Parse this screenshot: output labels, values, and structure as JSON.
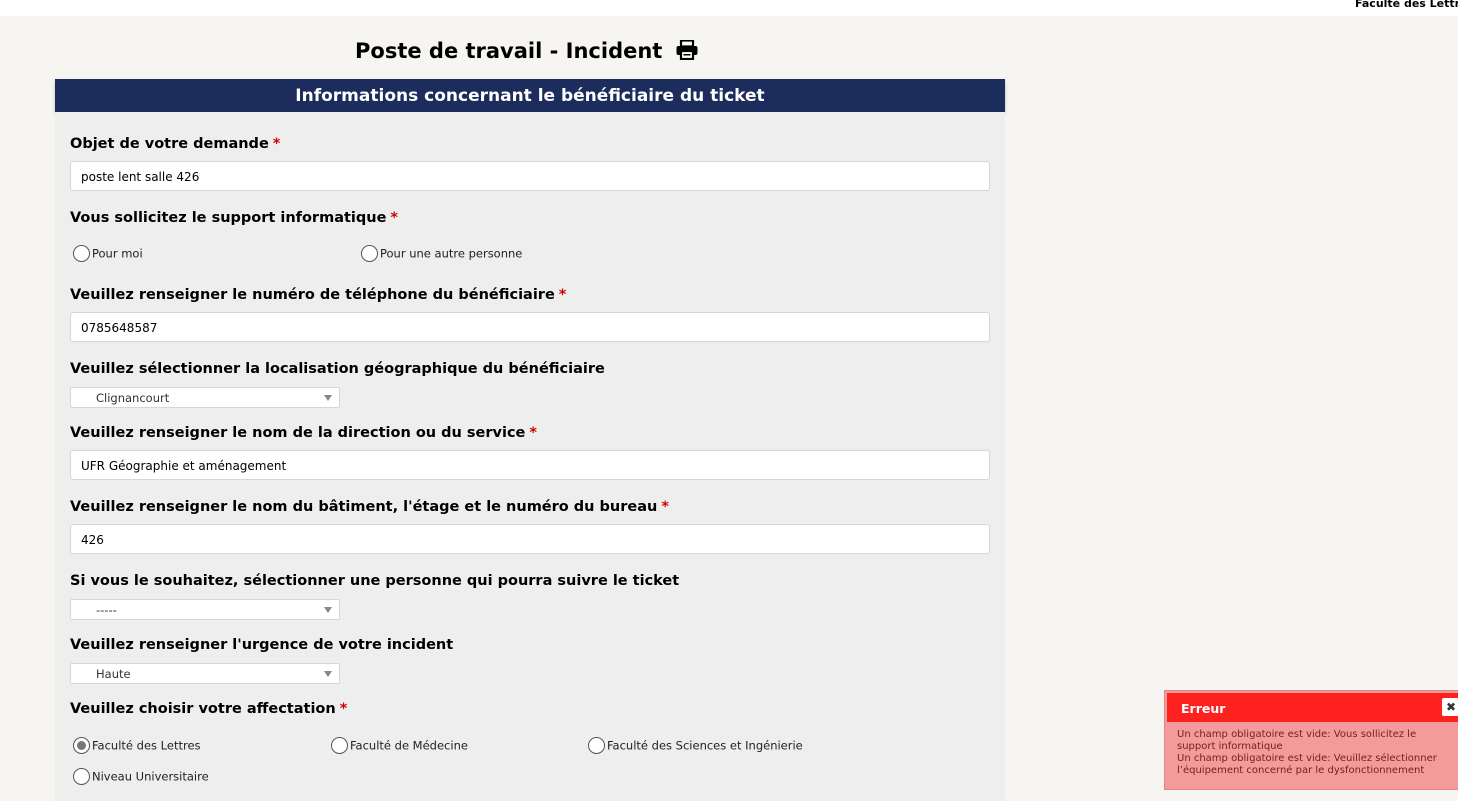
{
  "topbar": {
    "right_text": "Faculté des Lettres"
  },
  "page": {
    "title": "Poste de travail - Incident"
  },
  "section": {
    "header": "Informations concernant le bénéficiaire du ticket"
  },
  "form": {
    "objet": {
      "label": "Objet de votre demande",
      "value": "poste lent salle 426"
    },
    "support": {
      "label": "Vous sollicitez le support informatique",
      "options": [
        "Pour moi",
        "Pour une autre personne"
      ],
      "selected": null
    },
    "telephone": {
      "label": "Veuillez renseigner le numéro de téléphone du bénéficiaire",
      "value": "0785648587"
    },
    "localisation": {
      "label": "Veuillez sélectionner la localisation géographique du bénéficiaire",
      "value": "Clignancourt"
    },
    "direction": {
      "label": "Veuillez renseigner le nom de la direction ou du service",
      "value": "UFR Géographie et aménagement"
    },
    "batiment": {
      "label": "Veuillez renseigner le nom du bâtiment, l'étage et le numéro du bureau",
      "value": "426"
    },
    "suivi": {
      "label": "Si vous le souhaitez, sélectionner une personne qui pourra suivre le ticket",
      "value": "-----"
    },
    "urgence": {
      "label": "Veuillez renseigner l'urgence de votre incident",
      "value": "Haute"
    },
    "affectation": {
      "label": "Veuillez choisir votre affectation",
      "options": [
        "Faculté des Lettres",
        "Faculté de Médecine",
        "Faculté des Sciences et Ingénierie",
        "Niveau Universitaire"
      ],
      "selected": "Faculté des Lettres"
    },
    "required_mark": "*"
  },
  "error": {
    "title": "Erreur",
    "close": "✖",
    "messages": [
      "Un champ obligatoire est vide: Vous sollicitez le support informatique",
      "Un champ obligatoire est vide: Veuillez sélectionner l’équipement concerné par le dysfonctionnement"
    ]
  },
  "colors": {
    "header_bg": "#1c2c5c",
    "error_head": "#ff2020",
    "error_body": "#f39b9b",
    "required": "#d00000"
  },
  "icons": {
    "print": "print-icon",
    "dropdown": "chevron-down-icon",
    "close": "close-icon"
  }
}
